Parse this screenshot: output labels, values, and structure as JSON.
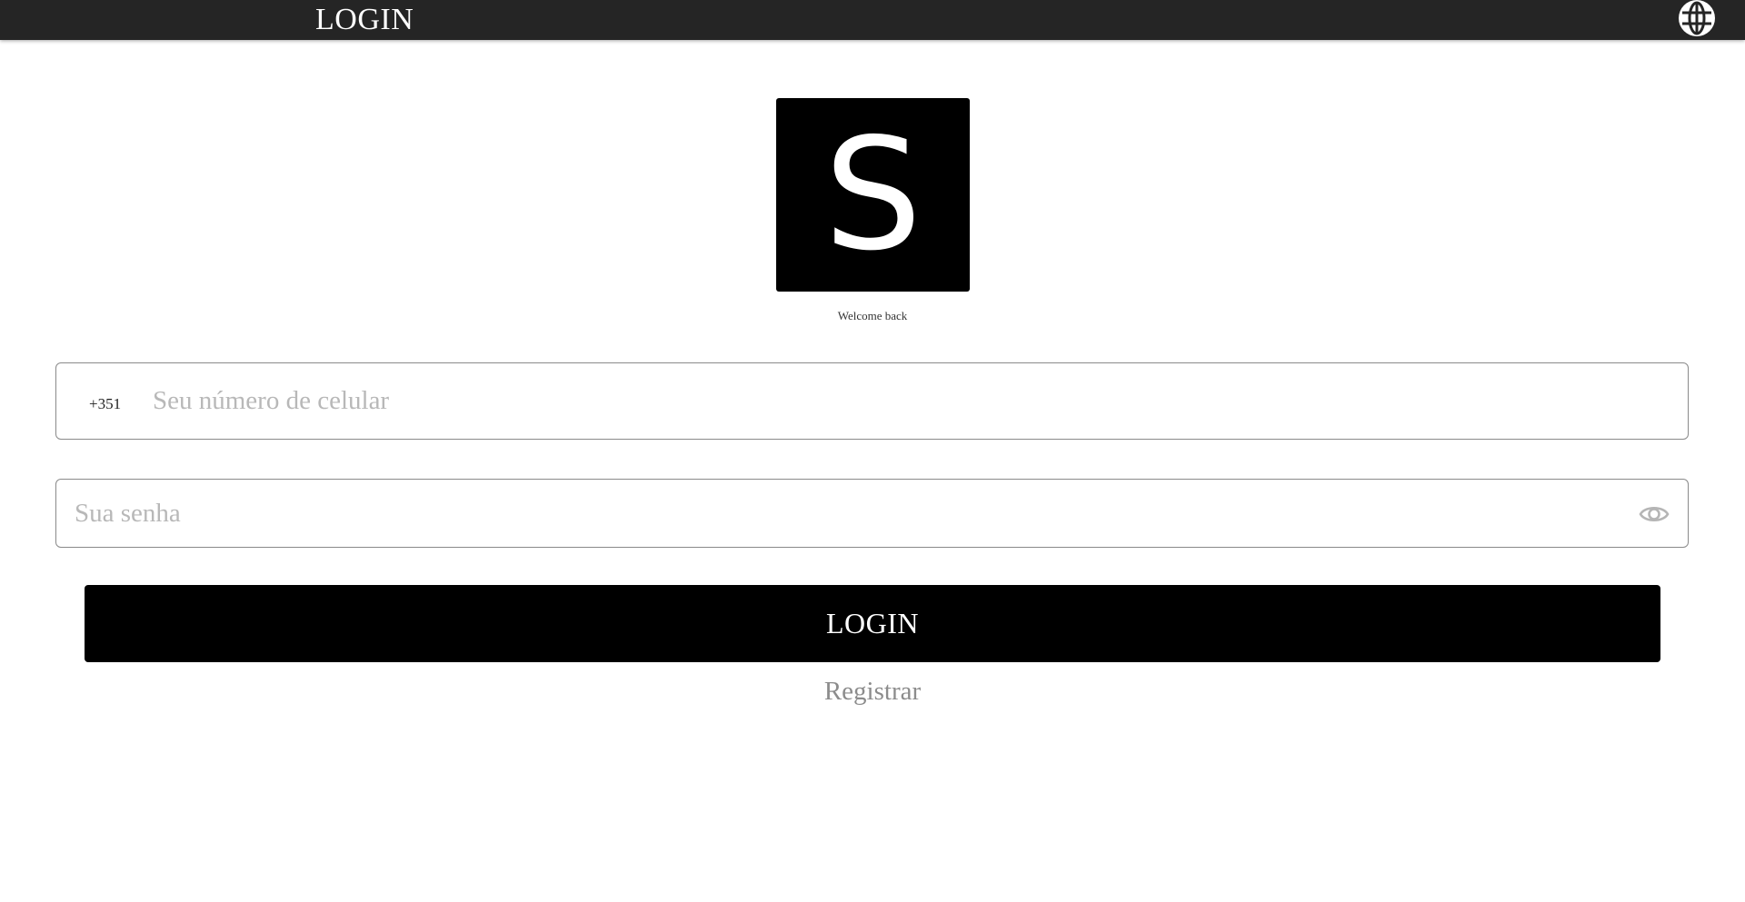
{
  "header": {
    "title": "LOGIN",
    "language_icon": "globe-icon"
  },
  "brand": {
    "logo_letter": "S",
    "welcome_text": "Welcome back"
  },
  "form": {
    "phone": {
      "country_code": "+351",
      "value": "",
      "placeholder": "Seu número de celular"
    },
    "password": {
      "value": "",
      "placeholder": "Sua senha",
      "toggle_icon": "eye-icon"
    },
    "submit_label": "LOGIN",
    "register_label": "Registrar"
  },
  "colors": {
    "header_bg": "#252525",
    "button_bg": "#000000",
    "placeholder": "#b8b8b8",
    "link": "#8c8c8c"
  }
}
